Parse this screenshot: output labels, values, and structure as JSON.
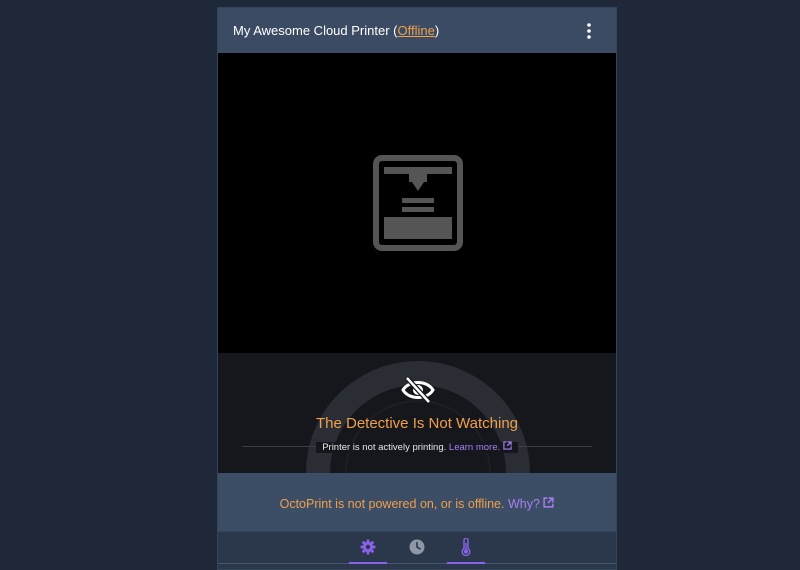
{
  "header": {
    "printer_name": "My Awesome Cloud Printer",
    "status_open": "(",
    "status": "Offline",
    "status_close": ")",
    "menu_icon": "vertical-ellipsis-icon"
  },
  "video": {
    "placeholder_icon": "3d-printer-icon"
  },
  "detective": {
    "icon": "eye-slash-icon",
    "title": "The Detective Is Not Watching",
    "subtitle": "Printer is not actively printing.",
    "learn_more": "Learn more.",
    "learn_more_icon": "external-link-icon"
  },
  "offline_notice": {
    "message": "OctoPrint is not powered on, or is offline.",
    "why_link": "Why?",
    "why_icon": "external-link-icon"
  },
  "tabs": [
    {
      "icon": "gear-icon",
      "active": true
    },
    {
      "icon": "clock-icon",
      "active": false
    },
    {
      "icon": "thermometer-icon",
      "active": true
    }
  ],
  "colors": {
    "background": "#1f2838",
    "card": "#2b384b",
    "header": "#3a4b63",
    "accent_orange": "#f0a04b",
    "accent_purple": "#a780f2"
  }
}
